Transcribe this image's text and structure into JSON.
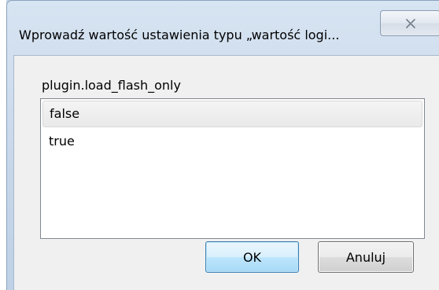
{
  "dialog": {
    "title": "Wprowadź wartość ustawienia typu „wartość logi...",
    "close_icon": "close-x-icon",
    "preference_name": "plugin.load_flash_only",
    "options": [
      {
        "label": "false",
        "selected": true
      },
      {
        "label": "true",
        "selected": false
      }
    ],
    "ok_label": "OK",
    "cancel_label": "Anuluj"
  },
  "colors": {
    "frame": "#c6d6e9",
    "client": "#f0f0f0",
    "ok_border": "#3c7fb1",
    "close_glyph": "#5f6b7a"
  }
}
